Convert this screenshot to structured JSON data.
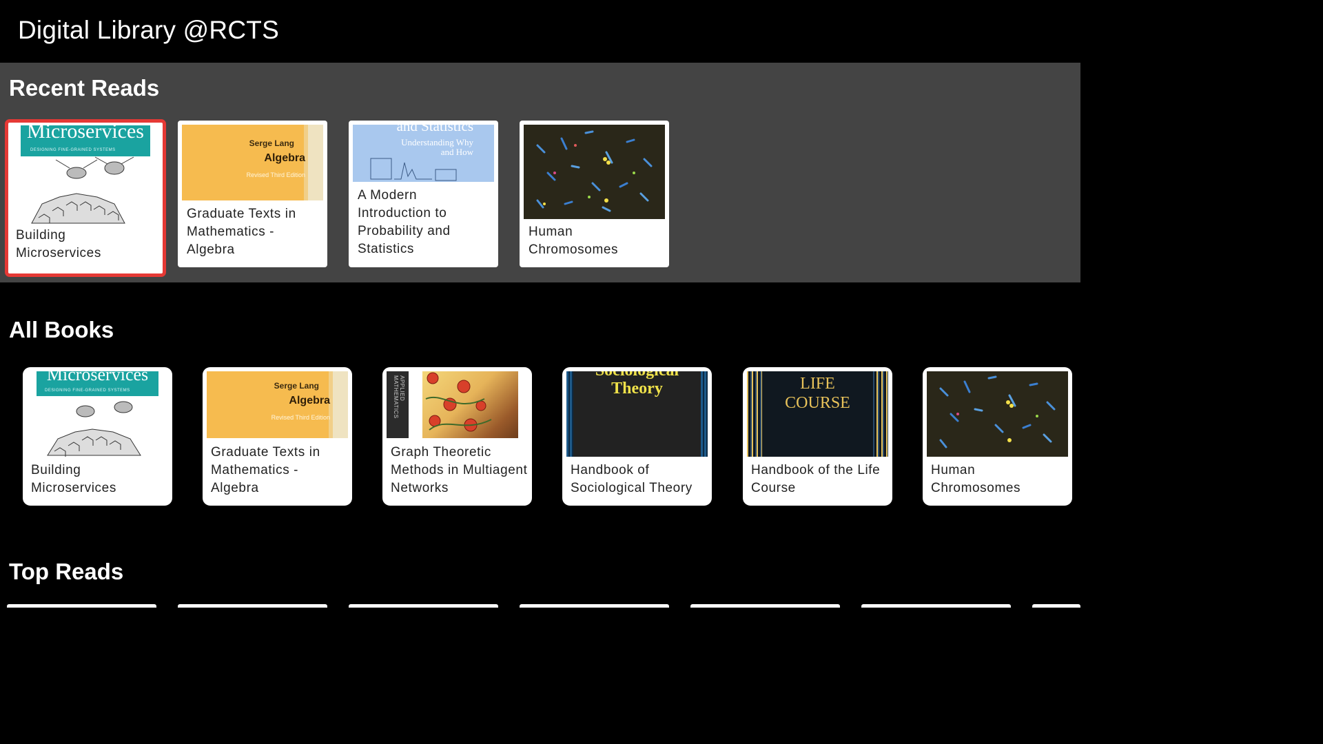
{
  "app": {
    "title": "Digital Library @RCTS"
  },
  "sections": {
    "recent": {
      "title": "Recent Reads"
    },
    "all": {
      "title": "All Books"
    },
    "top": {
      "title": "Top Reads"
    }
  },
  "recent_books": [
    {
      "title": "Building Microservices",
      "cover": "microservices",
      "focused": true
    },
    {
      "title": "Graduate Texts in Mathematics - Algebra",
      "cover": "algebra"
    },
    {
      "title": "A Modern Introduction to Probability and Statistics",
      "cover": "probability"
    },
    {
      "title": "Human Chromosomes",
      "cover": "chromosomes"
    }
  ],
  "all_books": [
    {
      "title": "Building Microservices",
      "cover": "microservices"
    },
    {
      "title": "Graduate Texts in Mathematics - Algebra",
      "cover": "algebra"
    },
    {
      "title": "Graph Theoretic Methods in Multiagent Networks",
      "cover": "graph"
    },
    {
      "title": "Handbook of Sociological Theory",
      "cover": "sociology"
    },
    {
      "title": "Handbook of the Life Course",
      "cover": "life-course"
    },
    {
      "title": "Human Chromosomes",
      "cover": "chromosomes"
    }
  ],
  "covers": {
    "microservices": {
      "title": "Microservices",
      "subtitle": "DESIGNING FINE-GRAINED SYSTEMS"
    },
    "algebra": {
      "author": "Serge Lang",
      "title": "Algebra",
      "edition": "Revised Third Edition"
    },
    "probability": {
      "line1": "and Statistics",
      "line2": "Understanding Why",
      "line3": "and How"
    },
    "graph": {
      "spine": "APPLIED MATHEMATICS"
    },
    "sociology": {
      "line1": "Sociological",
      "line2": "Theory"
    },
    "life_course": {
      "line1": "LIFE",
      "line2": "COURSE"
    }
  },
  "colors": {
    "focus": "#e53935",
    "recent_bg": "#444444",
    "background": "#000000"
  }
}
